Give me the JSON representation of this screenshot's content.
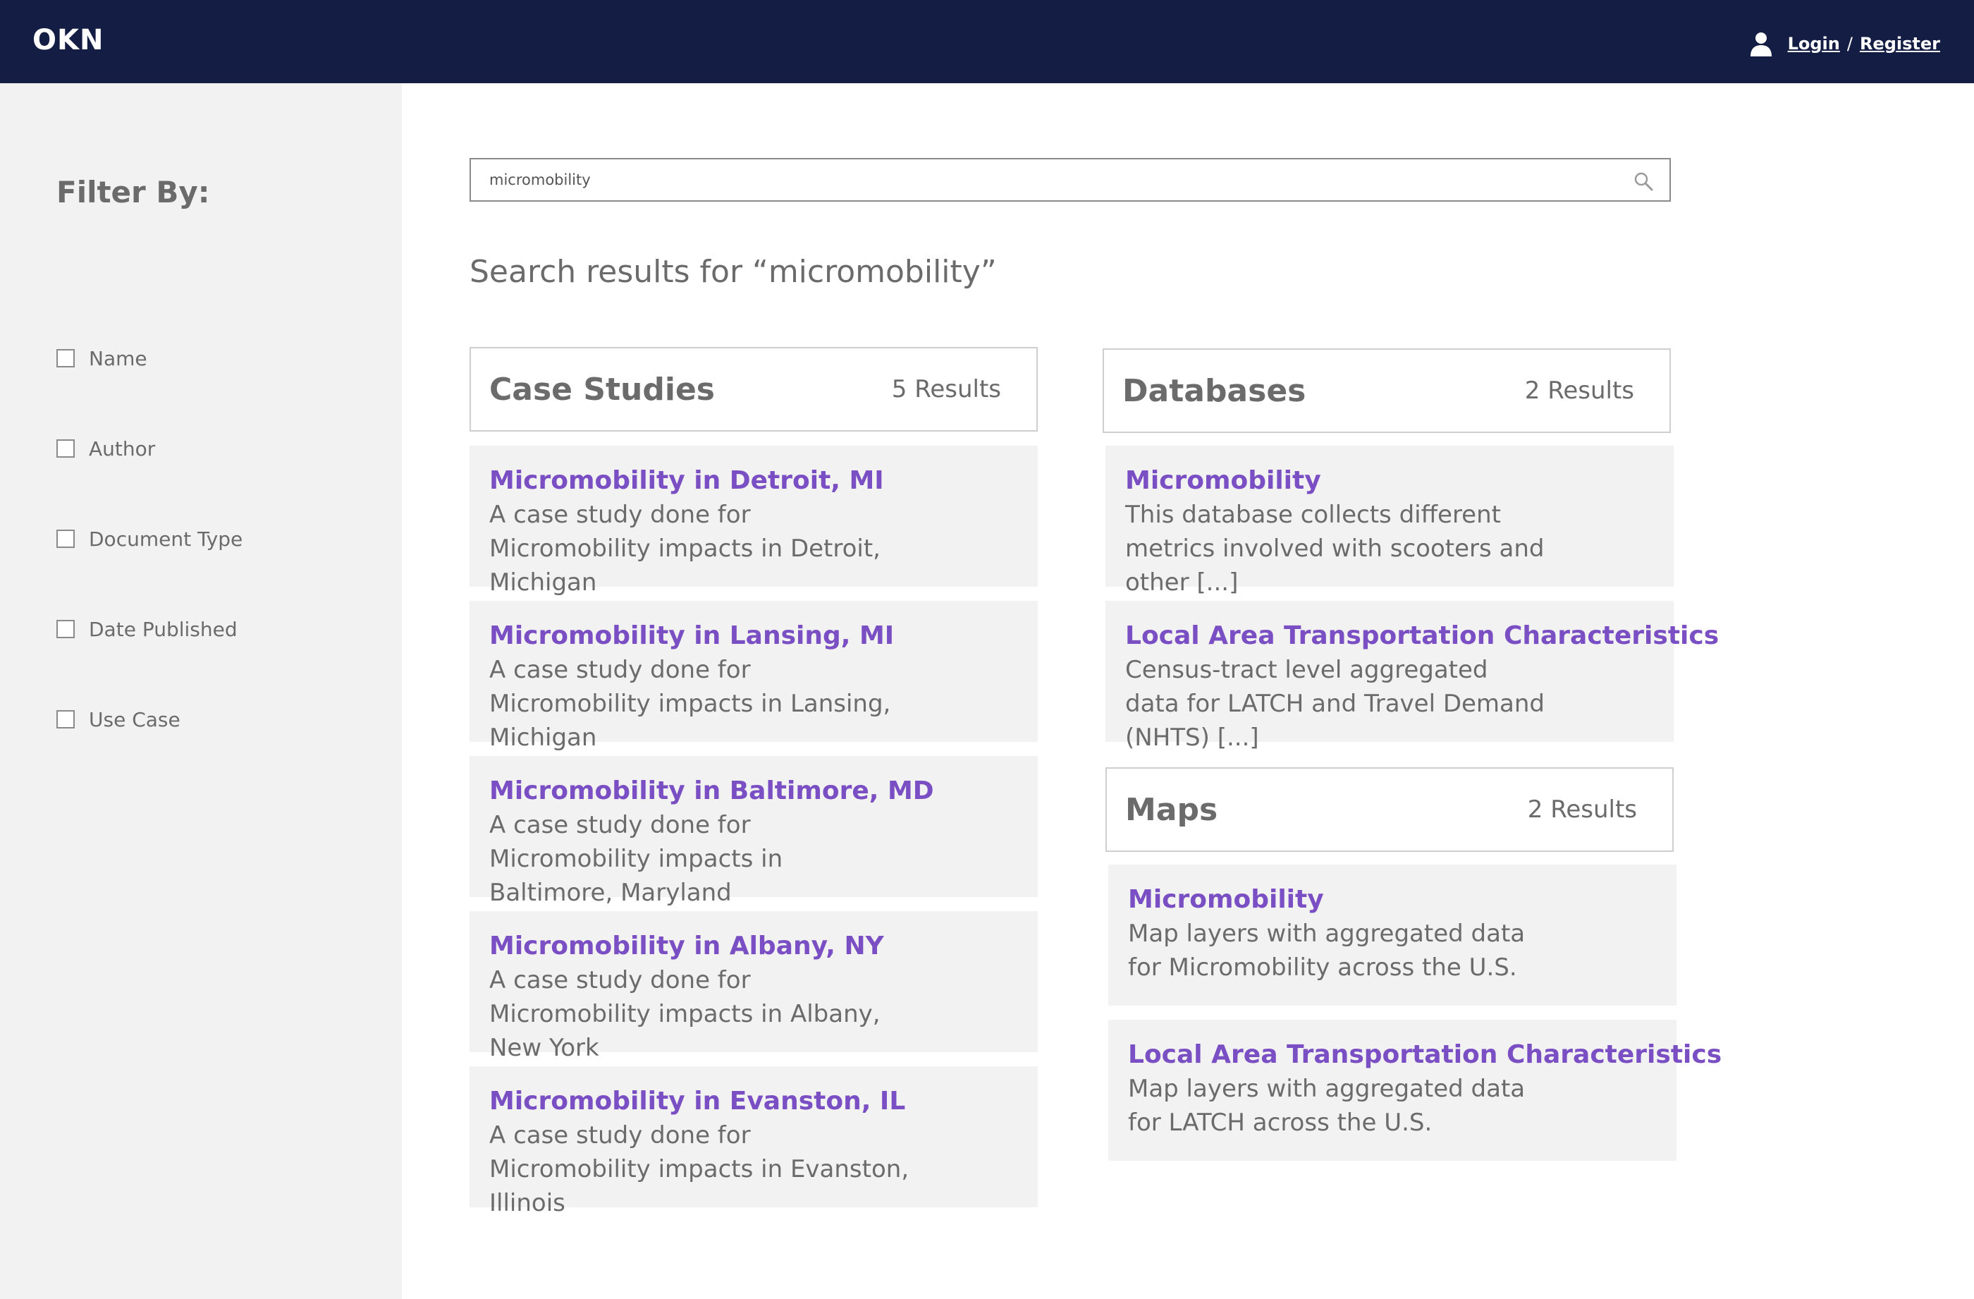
{
  "header": {
    "logo": "OKN",
    "login": "Login",
    "separator": "/",
    "register": "Register"
  },
  "sidebar": {
    "title": "Filter By:",
    "filters": [
      "Name",
      "Author",
      "Document Type",
      "Date Published",
      "Use Case"
    ]
  },
  "search": {
    "value": "micromobility"
  },
  "results_title": "Search results for “micromobility”",
  "case_studies": {
    "title": "Case Studies",
    "count": "5 Results",
    "items": [
      {
        "title": "Micromobility in Detroit, MI",
        "desc": "A case study done for Micromobility impacts in Detroit, Michigan"
      },
      {
        "title": "Micromobility in Lansing, MI",
        "desc": "A case study done for Micromobility impacts in Lansing, Michigan"
      },
      {
        "title": "Micromobility in Baltimore, MD",
        "desc": "A case study done for Micromobility impacts in Baltimore, Maryland"
      },
      {
        "title": "Micromobility in Albany, NY",
        "desc": "A case study done for Micromobility impacts in Albany, New York"
      },
      {
        "title": "Micromobility in Evanston, IL",
        "desc": "A case study done for Micromobility impacts in Evanston, Illinois"
      }
    ]
  },
  "databases": {
    "title": "Databases",
    "count": "2 Results",
    "items": [
      {
        "title": "Micromobility",
        "desc": "This database collects different metrics involved with scooters and other [...]"
      },
      {
        "title": "Local Area Transportation Characteristics",
        "desc": "Census-tract level aggregated data for LATCH and Travel Demand (NHTS) [...]"
      }
    ]
  },
  "maps": {
    "title": "Maps",
    "count": "2 Results",
    "items": [
      {
        "title": "Micromobility",
        "desc": "Map layers with aggregated data for Micromobility across the U.S."
      },
      {
        "title": "Local Area Transportation Characteristics",
        "desc": "Map layers with aggregated data for LATCH across the U.S."
      }
    ]
  },
  "colors": {
    "header_bg": "#141e44",
    "accent": "#7b4fc4",
    "sidebar_bg": "#f2f2f2",
    "card_bg": "#f2f2f2"
  },
  "icons": [
    "user-icon",
    "search-icon"
  ]
}
